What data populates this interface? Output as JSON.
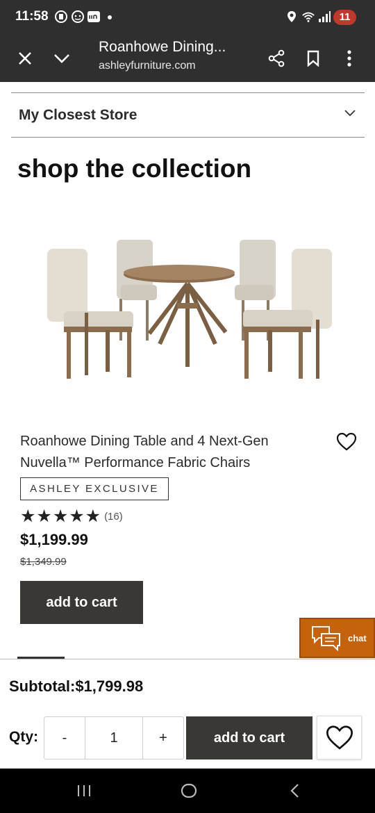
{
  "status_bar": {
    "time": "11:58",
    "notification_count": "11",
    "left_icons": [
      "circle-app-icon",
      "android-head-icon",
      "ring-app-icon",
      "dot-icon"
    ],
    "right_icons": [
      "location-icon",
      "wifi-icon",
      "signal-icon"
    ]
  },
  "toolbar": {
    "page_title": "Roanhowe Dining...",
    "url": "ashleyfurniture.com",
    "icons": [
      "close-icon",
      "chevron-down-icon",
      "share-icon",
      "bookmark-icon",
      "more-vert-icon"
    ]
  },
  "store": {
    "label": "My Closest Store"
  },
  "section": {
    "title": "shop the collection"
  },
  "product": {
    "name": "Roanhowe Dining Table and 4 Next-Gen Nuvella™ Performance Fabric Chairs",
    "badge": "ASHLEY EXCLUSIVE",
    "stars": "★★★★★",
    "rating_value": 5,
    "review_count": "(16)",
    "price": "$1,199.99",
    "original_price": "$1,349.99",
    "add_to_cart_label": "add to cart"
  },
  "chat": {
    "label": "chat",
    "color": "#c6620c"
  },
  "cart_bar": {
    "subtotal": "Subtotal:$1,799.98",
    "qty_label": "Qty:",
    "minus": "-",
    "qty_value": "1",
    "plus": "+",
    "add_to_cart_label": "add to cart"
  },
  "colors": {
    "chrome": "#2f2f2f",
    "button": "#3a3835",
    "badge": "#c0392b"
  }
}
